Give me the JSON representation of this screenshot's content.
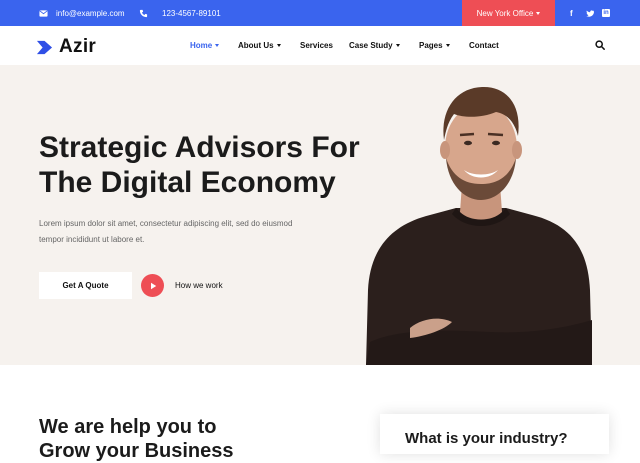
{
  "topbar": {
    "email": "info@example.com",
    "phone": "123-4567-89101",
    "office": "New York Office",
    "social": [
      "f",
      "t",
      "in"
    ]
  },
  "brand": {
    "name": "Azir"
  },
  "menu": [
    {
      "label": "Home",
      "dropdown": true,
      "active": true
    },
    {
      "label": "About Us",
      "dropdown": true
    },
    {
      "label": "Services",
      "dropdown": false
    },
    {
      "label": "Case Study",
      "dropdown": true
    },
    {
      "label": "Pages",
      "dropdown": true
    },
    {
      "label": "Contact",
      "dropdown": false
    }
  ],
  "hero": {
    "title_line1": "Strategic Advisors For",
    "title_line2": "The Digital Economy",
    "text_line1": "Lorem ipsum dolor sit amet, consectetur adipiscing elit, sed do eiusmod",
    "text_line2": "tempor incididunt ut labore et.",
    "cta": "Get A Quote",
    "video_label": "How we work"
  },
  "section": {
    "title_line1": "We are help you to",
    "title_line2": "Grow your Business"
  },
  "card": {
    "title": "What is your industry?"
  },
  "colors": {
    "accent": "#3a64ee",
    "red": "#ee4e55",
    "hero_bg": "#f6f2ee"
  }
}
